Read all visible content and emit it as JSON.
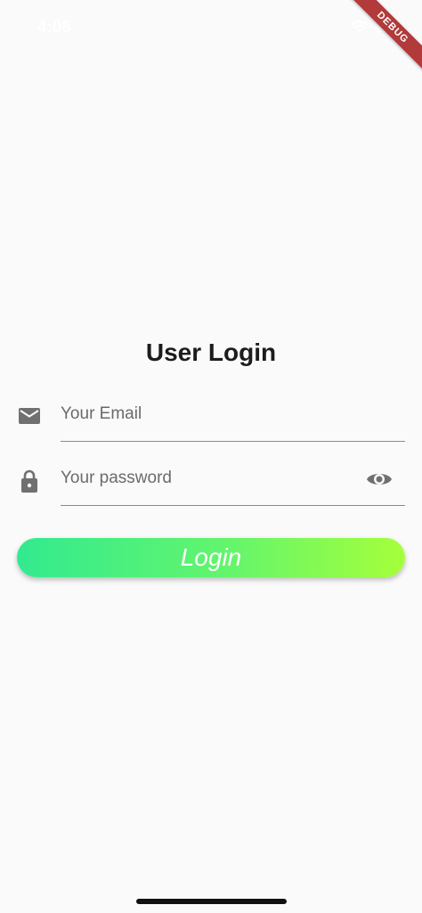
{
  "status_bar": {
    "time": "4:08",
    "wifi_icon": "wifi-icon",
    "battery_icon": "battery-icon"
  },
  "debug_banner": {
    "label": "DEBUG"
  },
  "page": {
    "title": "User Login"
  },
  "email_field": {
    "icon": "mail-icon",
    "placeholder": "Your Email"
  },
  "password_field": {
    "icon": "lock-icon",
    "placeholder": "Your password",
    "toggle_icon": "eye-icon"
  },
  "login_button": {
    "label": "Login"
  },
  "colors": {
    "background": "#fafafa",
    "icon_gray": "#707070",
    "gradient_start": "#32ea8f",
    "gradient_end": "#a6ff3a",
    "debug_ribbon": "#b23a3a"
  }
}
